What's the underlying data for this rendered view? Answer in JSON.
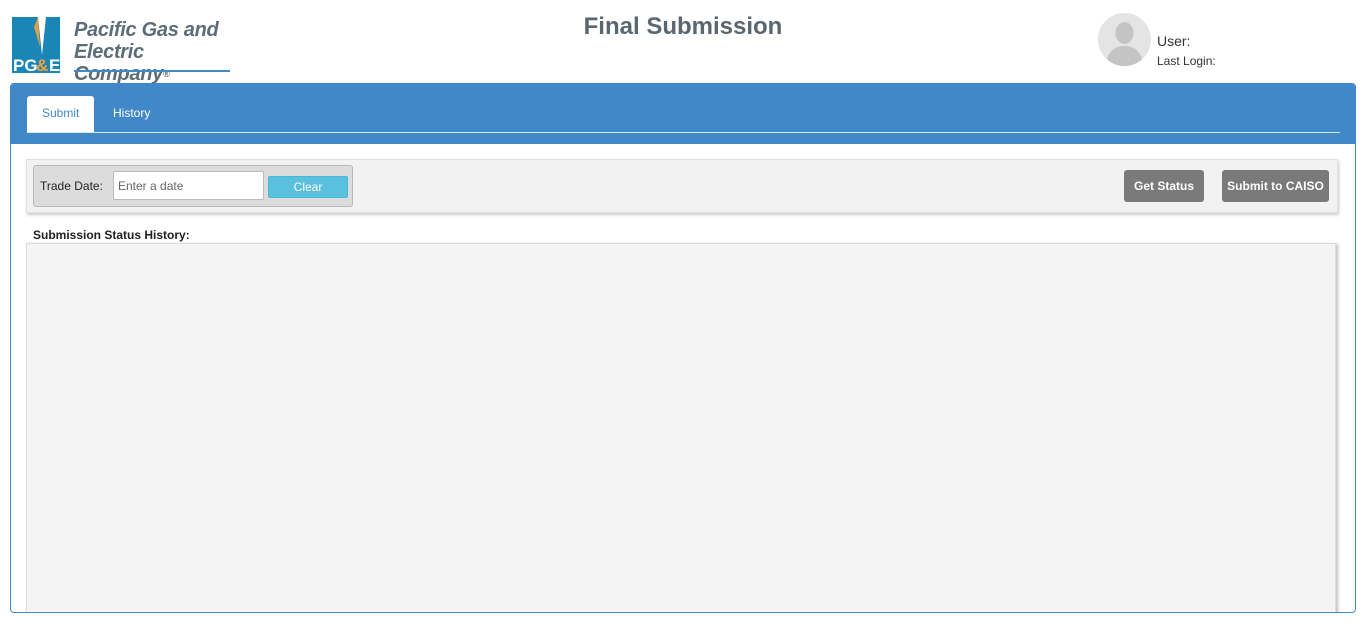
{
  "brand": {
    "logo_mark": "PG&E",
    "line1": "Pacific Gas and",
    "line2": "Electric Company",
    "registered": "®",
    "colors": {
      "blue": "#1a86b8",
      "orange": "#f4a13b"
    }
  },
  "header": {
    "title": "Final Submission",
    "user_label": "User:",
    "last_login_label": "Last Login:"
  },
  "tabs": [
    {
      "label": "Submit",
      "active": true
    },
    {
      "label": "History",
      "active": false
    }
  ],
  "toolbar": {
    "trade_date_label": "Trade Date:",
    "trade_date_value": "",
    "trade_date_placeholder": "Enter a date",
    "clear_label": "Clear",
    "get_status_label": "Get Status",
    "submit_caiso_label": "Submit to CAISO"
  },
  "history": {
    "label": "Submission Status History:",
    "rows": []
  },
  "colors": {
    "panel_blue": "#4188c8",
    "clear_button": "#5bc0de",
    "action_button": "#7a7a7a"
  }
}
